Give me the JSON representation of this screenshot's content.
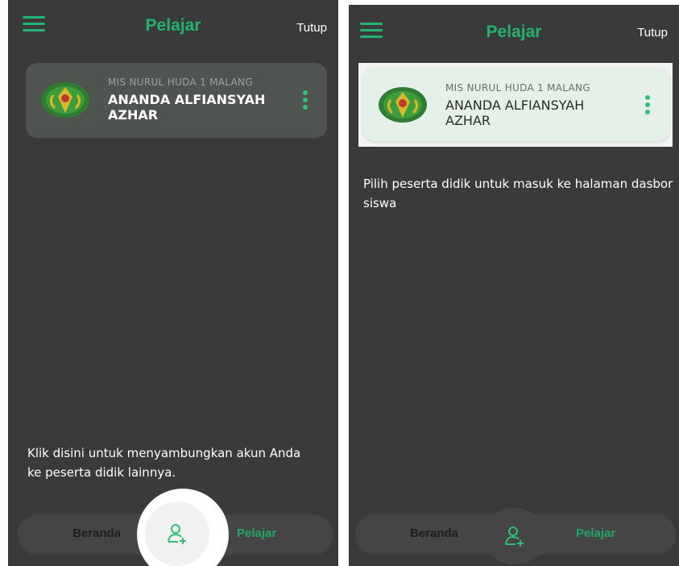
{
  "left": {
    "header": {
      "title": "Pelajar",
      "close_label": "Tutup"
    },
    "card": {
      "school": "MIS NURUL HUDA 1 MALANG",
      "student": "ANANDA ALFIANSYAH AZHAR"
    },
    "hint": "Klik disini untuk menyambungkan akun Anda ke peserta didik lainnya.",
    "tabbar": {
      "home_label": "Beranda",
      "students_label": "Pelajar",
      "fab_icon": "add-user-icon"
    }
  },
  "right": {
    "header": {
      "title": "Pelajar",
      "close_label": "Tutup"
    },
    "card": {
      "school": "MIS NURUL HUDA 1 MALANG",
      "student": "ANANDA ALFIANSYAH AZHAR"
    },
    "hint": "Pilih peserta didik untuk masuk ke halaman dasbor siswa",
    "tabbar": {
      "home_label": "Beranda",
      "students_label": "Pelajar",
      "fab_icon": "add-user-icon"
    }
  },
  "colors": {
    "accent": "#24b36e",
    "overlay": "#3a3a3a",
    "card_highlight": "#e5f0e8"
  }
}
